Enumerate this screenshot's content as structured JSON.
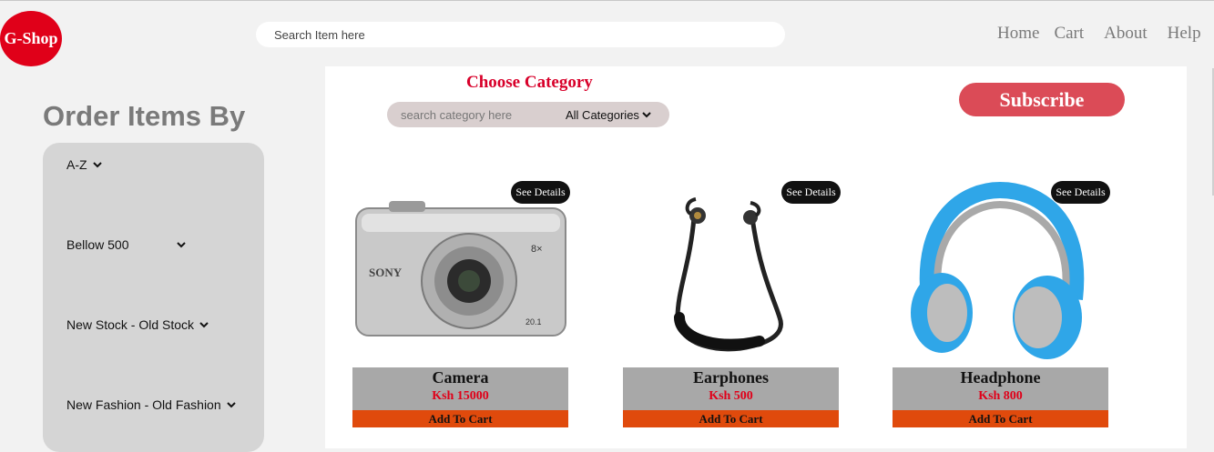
{
  "brand": {
    "logo": "G-Shop",
    "colors": {
      "logo": "#e00019",
      "accent": "#d8002a",
      "subscribe": "#db4b57",
      "add_to_cart": "#e04a0c"
    }
  },
  "header": {
    "search_placeholder": "Search Item here",
    "nav": [
      "Home",
      "Cart",
      "About",
      "Help"
    ]
  },
  "sidebar": {
    "title": "Order Items By",
    "filters": [
      "A-Z",
      "Bellow 500",
      "New Stock - Old Stock",
      "New Fashion - Old Fashion"
    ]
  },
  "category": {
    "title": "Choose Category",
    "search_placeholder": "search category here",
    "selected": "All Categories"
  },
  "subscribe_label": "Subscribe",
  "products": [
    {
      "name": "Camera",
      "price": "Ksh 15000",
      "details_label": "See Details",
      "cart_label": "Add To Cart",
      "icon": "camera-image"
    },
    {
      "name": "Earphones",
      "price": "Ksh 500",
      "details_label": "See Details",
      "cart_label": "Add To Cart",
      "icon": "earphones-image"
    },
    {
      "name": "Headphone",
      "price": "Ksh 800",
      "details_label": "See Details",
      "cart_label": "Add To Cart",
      "icon": "headphone-image"
    }
  ]
}
